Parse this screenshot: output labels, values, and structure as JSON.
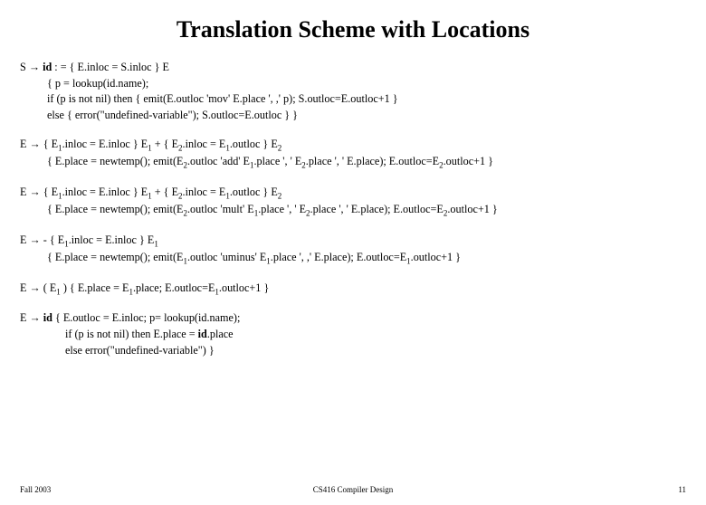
{
  "title": "Translation Scheme with Locations",
  "rules": {
    "r1": {
      "l1": "S → id : = { E.inloc = S.inloc } E",
      "l2": "{ p = lookup(id.name);",
      "l3": "if (p is not nil) then  { emit(E.outloc 'mov' E.place ', ,' p); S.outloc=E.outloc+1 }",
      "l4": "else { error(\"undefined-variable\"); S.outloc=E.outloc } }"
    },
    "r2": {
      "l1a": "E → { E",
      "l1b": ".inloc = E.inloc } E",
      "l1c": " + { E",
      "l1d": ".inloc = E",
      "l1e": ".outloc } E",
      "l2a": "{ E.place = newtemp();  emit(E",
      "l2b": ".outloc 'add' E",
      "l2c": ".place ', ' E",
      "l2d": ".place ', ' E.place);  E.outloc=E",
      "l2e": ".outloc+1 }"
    },
    "r3": {
      "l1a": "E → { E",
      "l1b": ".inloc = E.inloc } E",
      "l1c": " + { E",
      "l1d": ".inloc = E",
      "l1e": ".outloc } E",
      "l2a": "{ E.place = newtemp();  emit(E",
      "l2b": ".outloc 'mult' E",
      "l2c": ".place ', ' E",
      "l2d": ".place ', ' E.place);  E.outloc=E",
      "l2e": ".outloc+1 }"
    },
    "r4": {
      "l1a": "E → - { E",
      "l1b": ".inloc = E.inloc } E",
      "l2a": "{ E.place = newtemp(); emit(E",
      "l2b": ".outloc 'uminus' E",
      "l2c": ".place ', ,' E.place);  E.outloc=E",
      "l2d": ".outloc+1 }"
    },
    "r5": {
      "l1a": "E → ( E",
      "l1b": " )  { E.place = E",
      "l1c": ".place;  E.outloc=E",
      "l1d": ".outloc+1 }"
    },
    "r6": {
      "l1": "E → id { E.outloc = E.inloc; p= lookup(id.name);",
      "l2": "if (p is not nil) then E.place = id.place",
      "l3": "else error(\"undefined-variable\")  }"
    }
  },
  "sub": {
    "one": "1",
    "two": "2"
  },
  "bold": {
    "id": "id"
  },
  "footer": {
    "left": "Fall 2003",
    "center": "CS416 Compiler Design",
    "right": "11"
  }
}
